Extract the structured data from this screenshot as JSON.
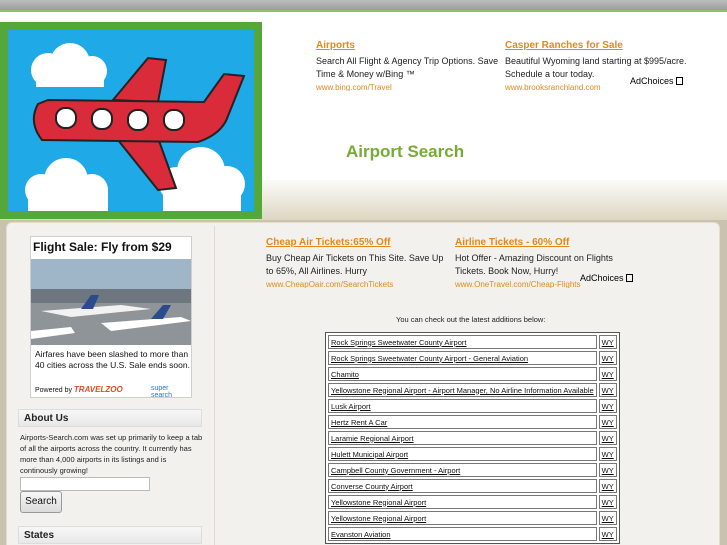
{
  "site_title": "Airport Search",
  "header_ads": [
    {
      "title": "Airports",
      "desc": "Search All Flight & Agency Trip Options. Save Time & Money w/Bing ™",
      "url": "www.bing.com/Travel"
    },
    {
      "title": "Casper Ranches for Sale",
      "desc": "Beautiful Wyoming land starting at $995/acre. Schedule a tour today.",
      "url": "www.brooksranchland.com"
    }
  ],
  "header_adchoices": "AdChoices",
  "content_ads": [
    {
      "title": "Cheap Air Tickets:65% Off",
      "desc": "Buy Cheap Air Tickets on This Site. Save Up to 65%, All Airlines. Hurry",
      "url": "www.CheapOair.com/SearchTickets"
    },
    {
      "title": "Airline Tickets - 60% Off",
      "desc": "Hot Offer - Amazing Discount on Flights Tickets. Book Now, Hurry!",
      "url": "www.OneTravel.com/Cheap-Flights"
    }
  ],
  "content_adchoices": "AdChoices",
  "banner": {
    "headline": "Flight Sale: Fly from $29",
    "text": "Airfares have been slashed to more than 40 cities across the U.S. Sale ends soon.",
    "powered_by": "Powered by",
    "brand": "TRAVELZOO",
    "partner": "super search"
  },
  "sidebar": {
    "about_title": "About Us",
    "about_text": "Airports-Search.com was set up primarily to keep a tab of all the airports across the country. It currently has more than 4,000 airports in its listings and is continously growing!",
    "search_button": "Search",
    "search_value": "",
    "states_title": "States"
  },
  "main": {
    "intro": "You can check out the latest additions below:",
    "airports": [
      {
        "name": "Rock Springs Sweetwater County Airport",
        "state": "WY"
      },
      {
        "name": "Rock Springs Sweetwater County Airport - General Aviation",
        "state": "WY"
      },
      {
        "name": "Chamito",
        "state": "WY"
      },
      {
        "name": "Yellowstone Regional Airport - Airport Manager, No Airline Information Available",
        "state": "WY"
      },
      {
        "name": "Lusk Airport",
        "state": "WY"
      },
      {
        "name": "Hertz Rent A Car",
        "state": "WY"
      },
      {
        "name": "Laramie Regional Airport",
        "state": "WY"
      },
      {
        "name": "Hulett Municipal Airport",
        "state": "WY"
      },
      {
        "name": "Campbell County Government - Airport",
        "state": "WY"
      },
      {
        "name": "Converse County Airport",
        "state": "WY"
      },
      {
        "name": "Yellowstone Regional Airport",
        "state": "WY"
      },
      {
        "name": "Yellowstone Regional Airport",
        "state": "WY"
      },
      {
        "name": "Evanston Aviation",
        "state": "WY"
      }
    ]
  },
  "colors": {
    "accent_green": "#76ab36",
    "link_orange": "#e08a1c",
    "logo_sky": "#1fa9e6",
    "logo_frame": "#56a73a",
    "plane_red": "#d92b3a"
  }
}
